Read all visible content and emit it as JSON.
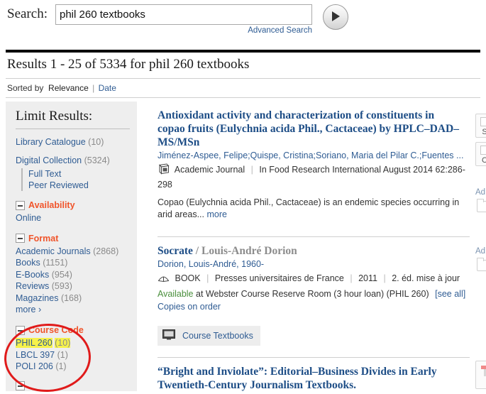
{
  "search": {
    "label": "Search:",
    "value": "phil 260 textbooks",
    "placeholder": "",
    "advanced_link": "Advanced Search",
    "go_icon": "play-triangle-icon"
  },
  "results_header": {
    "heading": "Results 1 - 25 of 5334 for phil 260 textbooks",
    "range_start": "1",
    "range_end": "25",
    "total": "5334",
    "query": "phil 260 textbooks",
    "sorted_by_label": "Sorted by",
    "sort_relevance": "Relevance",
    "sort_separator": "|",
    "sort_date": "Date"
  },
  "sidebar": {
    "title": "Limit Results:",
    "top_links": [
      {
        "label": "Library Catalogue",
        "count": "(10)"
      },
      {
        "label": "Digital Collection",
        "count": "(5324)"
      }
    ],
    "sub_links": [
      {
        "label": "Full Text"
      },
      {
        "label": "Peer Reviewed"
      }
    ],
    "facets": [
      {
        "title": "Availability",
        "collapse_icon": "minus-box-icon",
        "items": [
          {
            "label": "Online",
            "count": ""
          }
        ],
        "more": ""
      },
      {
        "title": "Format",
        "collapse_icon": "minus-box-icon",
        "items": [
          {
            "label": "Academic Journals",
            "count": "(2868)"
          },
          {
            "label": "Books",
            "count": "(1151)"
          },
          {
            "label": "E-Books",
            "count": "(954)"
          },
          {
            "label": "Reviews",
            "count": "(593)"
          },
          {
            "label": "Magazines",
            "count": "(168)"
          }
        ],
        "more": "more ›"
      },
      {
        "title": "Course Code",
        "collapse_icon": "minus-box-icon",
        "items": [
          {
            "label": "PHIL 260",
            "count": "(10)",
            "highlighted": true
          },
          {
            "label": "LBCL 397",
            "count": "(1)"
          },
          {
            "label": "POLI 206",
            "count": "(1)"
          }
        ],
        "more": ""
      }
    ],
    "annotation_color": "#e01b1b",
    "highlight_color": "#f6f24a",
    "facet_title_color": "#f0542a"
  },
  "results": [
    {
      "title": "Antioxidant activity and characterization of constituents in copao fruits (Eulychnia acida Phil., Cactaceae) by HPLC–DAD–MS/MSn",
      "byline": "",
      "authors": "Jiménez-Aspee, Felipe;Quispe, Cristina;Soriano, Maria del Pilar C.;Fuentes ...",
      "format_icon": "journal-icon",
      "format": "Academic Journal",
      "source": "In Food Research International August 2014 62:286-298",
      "abstract": "Copao (Eulychnia acida Phil., Cactaceae) is an endemic species occurring in arid areas...",
      "abstract_more": "more",
      "add_to_folder": "Ad",
      "tools": [
        {
          "letter": "S"
        },
        {
          "letter": "C"
        }
      ]
    },
    {
      "title": "Socrate",
      "byline": "/ Louis-André Dorion",
      "authors": "Dorion, Louis-André, 1960-",
      "format_icon": "book-icon",
      "format": "BOOK",
      "publisher": "Presses universitaires de France",
      "year": "2011",
      "edition": "2. éd. mise à jour",
      "availability_status": "Available",
      "availability_detail": "at Webster Course Reserve Room (3 hour loan) (PHIL 260)",
      "see_all": "[see all]",
      "copies_link": "Copies on order",
      "course_textbooks_icon": "monitor-icon",
      "course_textbooks_label": "Course Textbooks",
      "add_to_folder": "Ad"
    },
    {
      "title": "“Bright and Inviolate”: Editorial–Business Divides in Early Twentieth-Century Journalism Textbooks.",
      "byline": ""
    }
  ]
}
